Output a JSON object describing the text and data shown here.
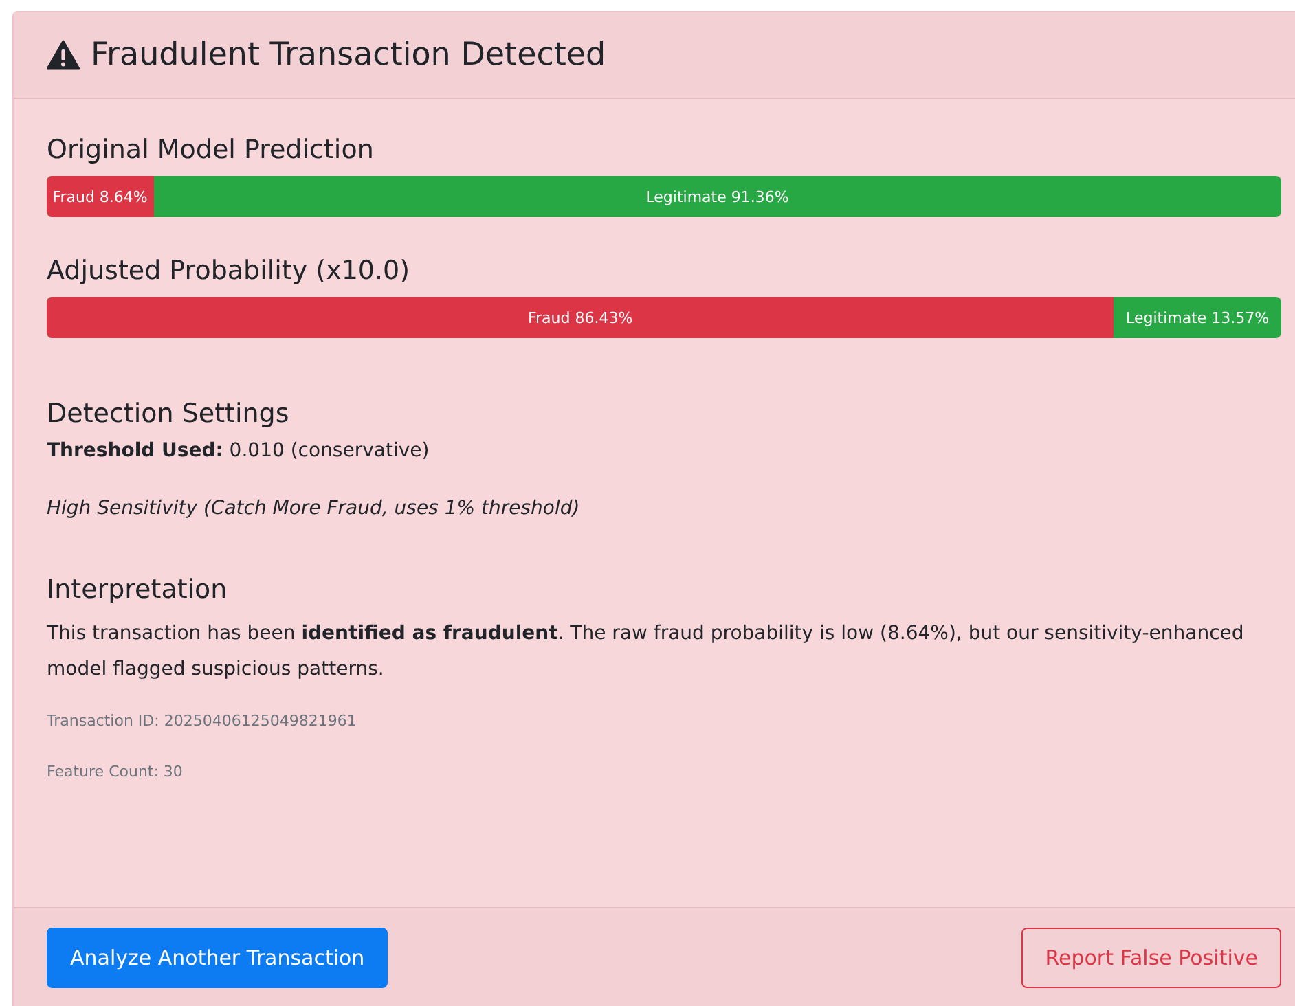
{
  "card": {
    "title": "Fraudulent Transaction Detected"
  },
  "predictions": [
    {
      "heading": "Original Model Prediction",
      "level": 0.0864,
      "fraud_label": "Fraud 8.64%",
      "legitimate_label": "Legitimate 91.36%"
    },
    {
      "heading": "Adjusted Probability (x10.0)",
      "level": 0.8643,
      "fraud_label": "Fraud 86.43%",
      "legitimate_label": "Legitimate 13.57%"
    }
  ],
  "settings": {
    "heading": "Detection Settings",
    "threshold": "**Threshold Used:** 0.010 (conservative)",
    "mode": "High Sensitivity (Catch More Fraud, uses 1% threshold)"
  },
  "interpretation": {
    "heading": "Interpretation",
    "text": "This transaction has been **identified as fraudulent**. The raw fraud probability is low (8.64%), but our sensitivity-enhanced model flagged suspicious patterns.",
    "transaction_id": "Transaction ID: 20250406125049821961",
    "feature_count": "Feature Count: 30"
  },
  "buttons": [
    {
      "kind": "primary",
      "label": "Analyze Another Transaction"
    },
    {
      "kind": "outline-danger",
      "label": "Report False Positive"
    }
  ]
}
